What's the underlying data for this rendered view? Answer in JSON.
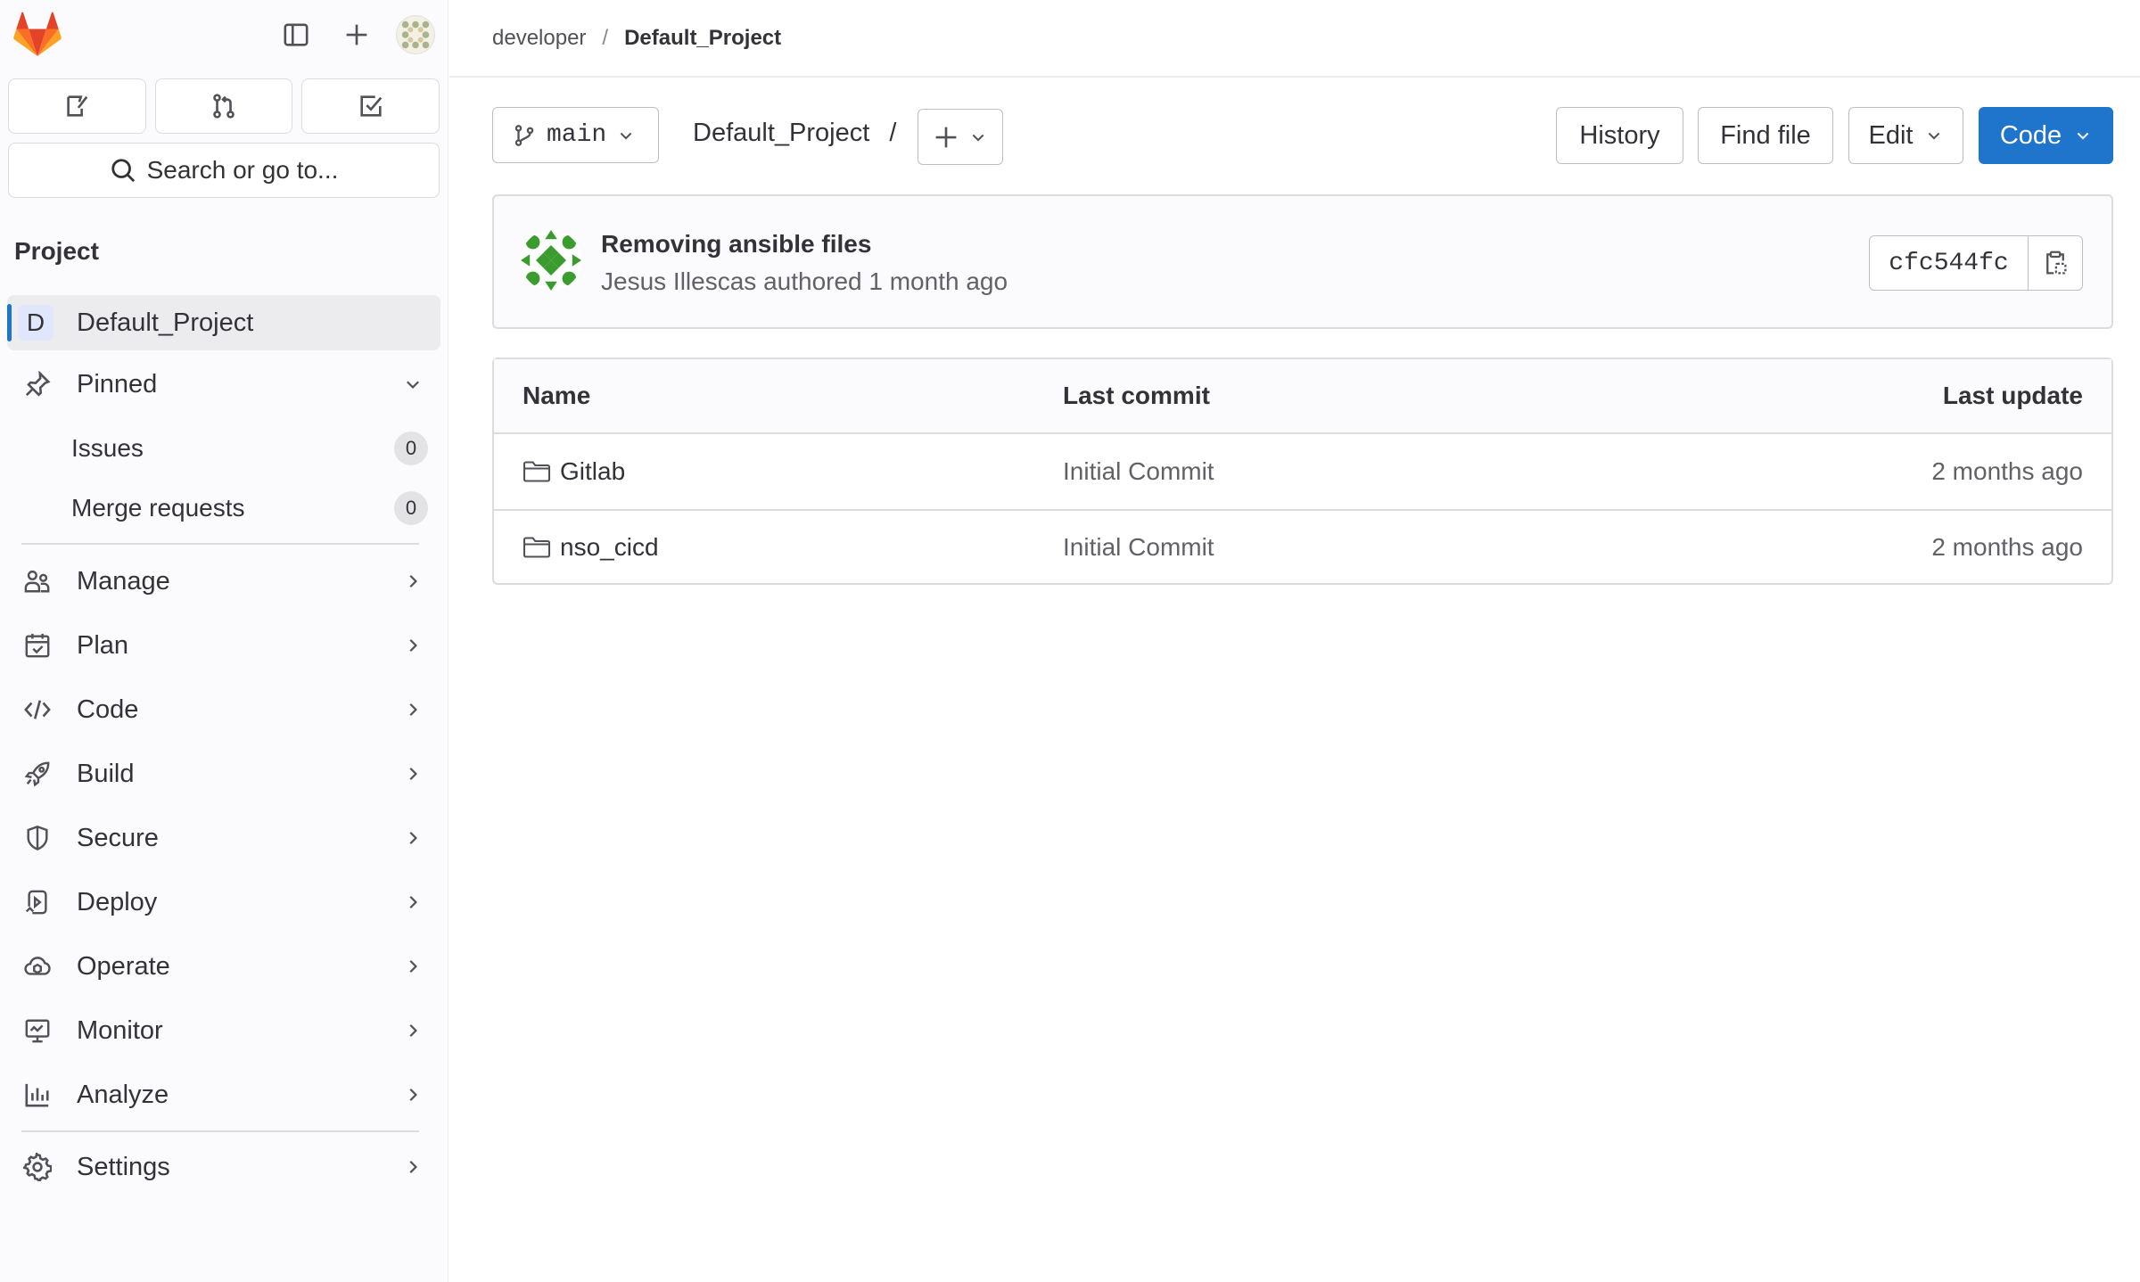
{
  "app": {
    "name": "GitLab"
  },
  "sidebar": {
    "search_label": "Search or go to...",
    "section_title": "Project",
    "project": {
      "letter": "D",
      "name": "Default_Project"
    },
    "pinned": {
      "label": "Pinned",
      "items": [
        {
          "label": "Issues",
          "count": "0"
        },
        {
          "label": "Merge requests",
          "count": "0"
        }
      ]
    },
    "nav": [
      {
        "label": "Manage",
        "icon": "users-icon"
      },
      {
        "label": "Plan",
        "icon": "calendar-icon"
      },
      {
        "label": "Code",
        "icon": "code-icon"
      },
      {
        "label": "Build",
        "icon": "rocket-icon"
      },
      {
        "label": "Secure",
        "icon": "shield-icon"
      },
      {
        "label": "Deploy",
        "icon": "deploy-icon"
      },
      {
        "label": "Operate",
        "icon": "cloud-icon"
      },
      {
        "label": "Monitor",
        "icon": "monitor-icon"
      },
      {
        "label": "Analyze",
        "icon": "chart-icon"
      }
    ],
    "settings_label": "Settings"
  },
  "breadcrumb": {
    "parent": "developer",
    "separator": "/",
    "current": "Default_Project"
  },
  "toolbar": {
    "branch": "main",
    "path": "Default_Project",
    "path_separator": "/",
    "history": "History",
    "find_file": "Find file",
    "edit": "Edit",
    "code": "Code"
  },
  "commit": {
    "title": "Removing ansible files",
    "meta": "Jesus Illescas authored 1 month ago",
    "sha": "cfc544fc"
  },
  "files": {
    "headers": {
      "name": "Name",
      "last_commit": "Last commit",
      "last_update": "Last update"
    },
    "rows": [
      {
        "name": "Gitlab",
        "commit": "Initial Commit",
        "updated": "2 months ago"
      },
      {
        "name": "nso_cicd",
        "commit": "Initial Commit",
        "updated": "2 months ago"
      }
    ]
  },
  "colors": {
    "primary": "#1f75cb",
    "active_bar": "#1f75cb",
    "logo_orange": "#fc6d26",
    "logo_red": "#e24329"
  }
}
